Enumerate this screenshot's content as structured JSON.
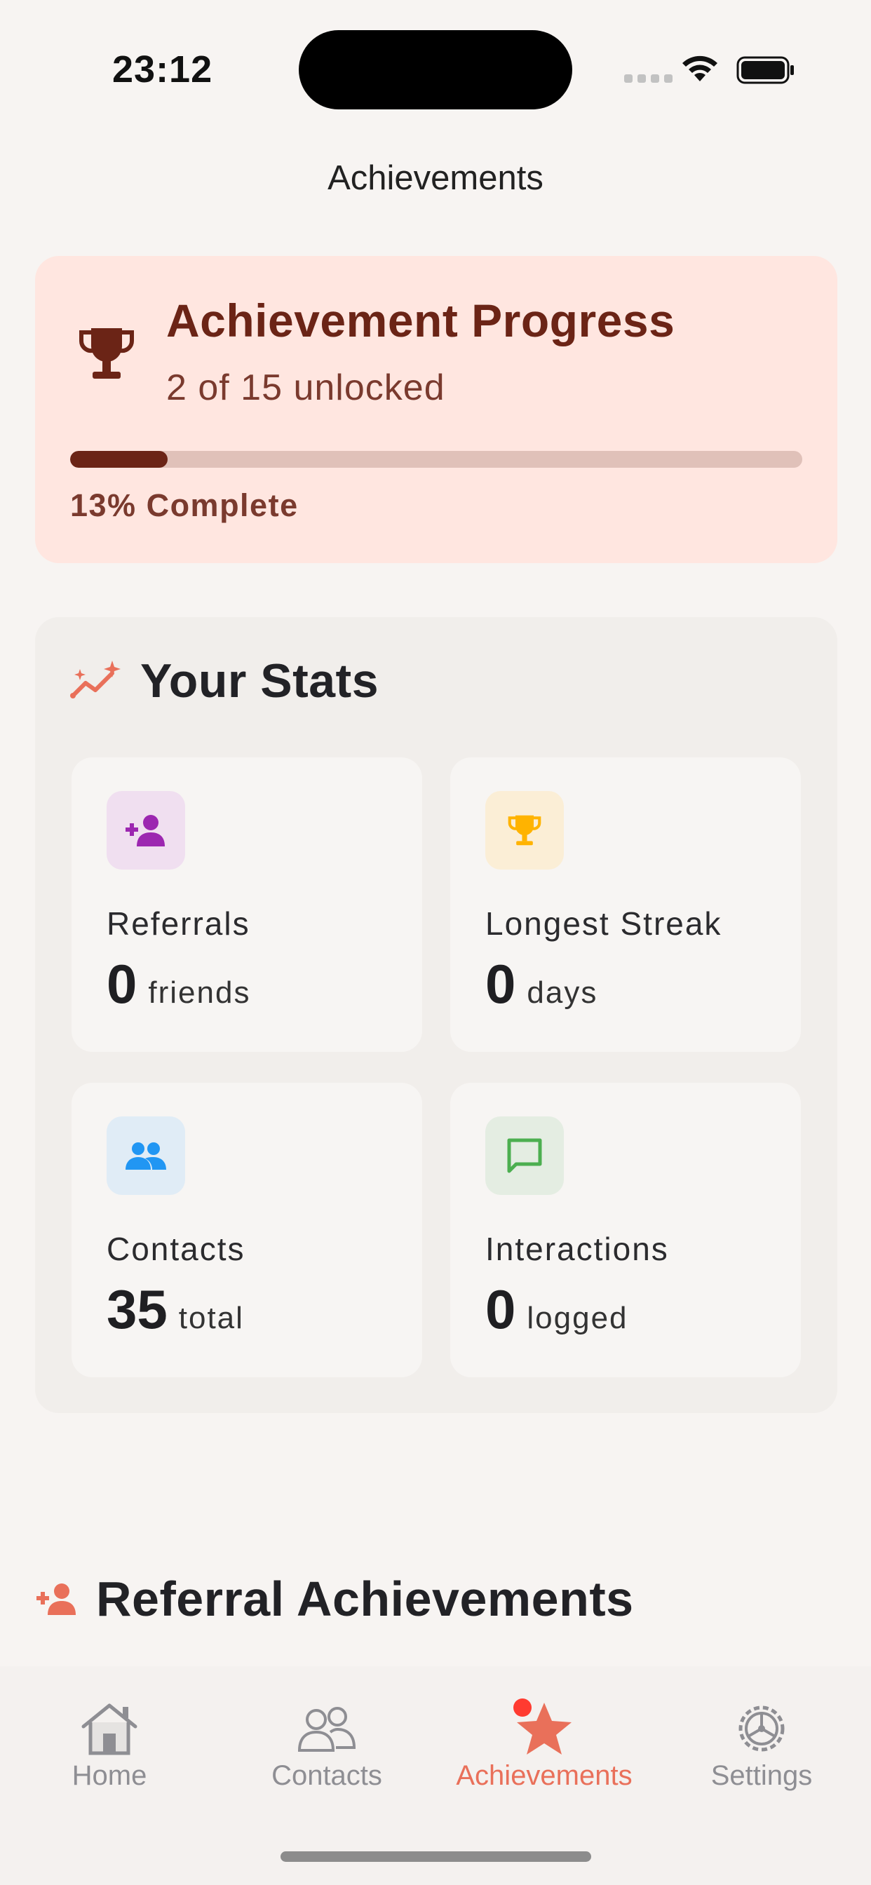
{
  "status_bar": {
    "time": "23:12"
  },
  "header": {
    "title": "Achievements"
  },
  "progress": {
    "title": "Achievement Progress",
    "subtitle": "2 of 15 unlocked",
    "percent_label": "13% Complete",
    "fraction_complete": 0.133,
    "icon": "trophy-icon"
  },
  "stats": {
    "title": "Your Stats",
    "icon": "sparkle-chart-icon",
    "items": [
      {
        "label": "Referrals",
        "value": "0",
        "unit": "friends",
        "icon": "add-person-icon",
        "icon_color": "#9c27b0",
        "bg": "#f0dff0"
      },
      {
        "label": "Longest Streak",
        "value": "0",
        "unit": "days",
        "icon": "trophy-icon",
        "icon_color": "#ffb300",
        "bg": "#fbeed6"
      },
      {
        "label": "Contacts",
        "value": "35",
        "unit": "total",
        "icon": "people-icon",
        "icon_color": "#2196f3",
        "bg": "#e0ecf6"
      },
      {
        "label": "Interactions",
        "value": "0",
        "unit": "logged",
        "icon": "chat-bubble-icon",
        "icon_color": "#4caf50",
        "bg": "#e4ede2"
      }
    ]
  },
  "referral_section": {
    "title": "Referral Achievements",
    "icon": "add-person-icon"
  },
  "tabbar": {
    "tabs": [
      {
        "label": "Home",
        "icon": "house-icon",
        "active": false
      },
      {
        "label": "Contacts",
        "icon": "people-icon",
        "active": false
      },
      {
        "label": "Achievements",
        "icon": "star-icon",
        "active": true,
        "badge": true
      },
      {
        "label": "Settings",
        "icon": "gear-icon",
        "active": false
      }
    ]
  },
  "colors": {
    "accent": "#e9705a",
    "progress_dark": "#6b2416",
    "progress_bg": "#ffe6e0",
    "background": "#f7f4f2"
  }
}
